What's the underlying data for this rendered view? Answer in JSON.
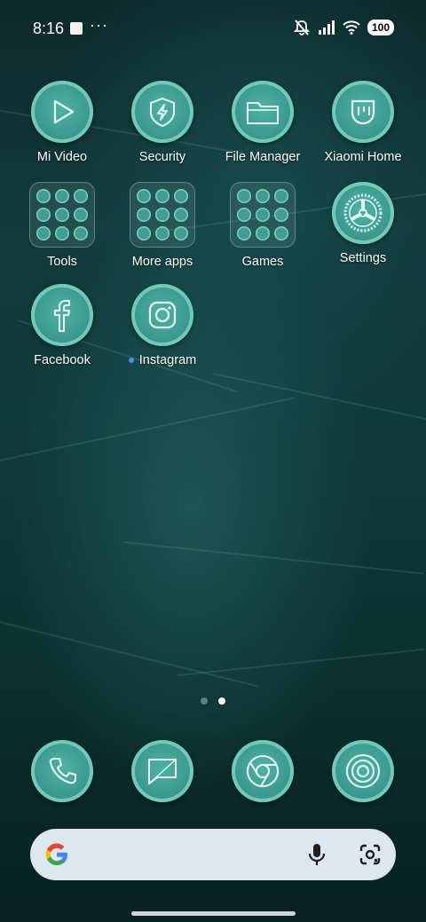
{
  "status_bar": {
    "time": "8:16",
    "more": "···",
    "battery": "100"
  },
  "apps": [
    {
      "label": "Mi Video",
      "icon": "play-icon"
    },
    {
      "label": "Security",
      "icon": "shield-bolt-icon"
    },
    {
      "label": "File Manager",
      "icon": "folder-icon"
    },
    {
      "label": "Xiaomi Home",
      "icon": "xiaomi-home-icon"
    },
    {
      "label": "Tools",
      "icon": "folder-group-icon"
    },
    {
      "label": "More apps",
      "icon": "folder-group-icon"
    },
    {
      "label": "Games",
      "icon": "folder-group-icon"
    },
    {
      "label": "Settings",
      "icon": "gear-icon"
    },
    {
      "label": "Facebook",
      "icon": "facebook-icon"
    },
    {
      "label": "Instagram",
      "icon": "instagram-icon",
      "new_dot": true
    }
  ],
  "page_indicator": {
    "count": 2,
    "active": 1
  },
  "dock": [
    {
      "icon": "phone-icon"
    },
    {
      "icon": "messages-icon"
    },
    {
      "icon": "chrome-icon"
    },
    {
      "icon": "camera-icon"
    }
  ],
  "colors": {
    "accent": "#4fb2a3",
    "ring": "#6fcbb8",
    "search_bg": "#dde7ef"
  }
}
